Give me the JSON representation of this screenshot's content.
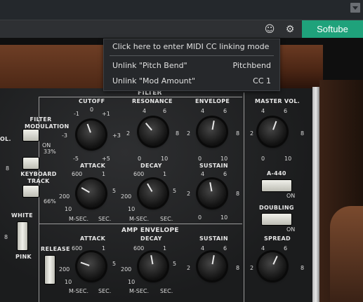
{
  "toolbar": {
    "brand": "Softube",
    "dropdown_icon": "chevron-down-icon",
    "face_icon": "face-icon",
    "settings_icon": "gear-icon"
  },
  "context_menu": {
    "items": [
      {
        "label": "Click here to enter MIDI CC linking mode",
        "shortcut": ""
      },
      {
        "label": "Unlink \"Pitch Bend\"",
        "shortcut": "Pitchbend"
      },
      {
        "label": "Unlink \"Mod Amount\"",
        "shortcut": "CC 1"
      }
    ]
  },
  "synth": {
    "section_filter": "FILTER",
    "section_amp": "AMP ENVELOPE",
    "filter_modulation": "FILTER MODULATION",
    "on": "ON",
    "keyboard_track": "KEYBOARD TRACK",
    "kbd_33": "33%",
    "kbd_66": "66%",
    "white": "WHITE",
    "pink": "PINK",
    "release": "RELEASE",
    "vol_partial": "OL.",
    "eight": "8",
    "cutoff": {
      "label": "CUTOFF",
      "ticks": [
        "-1",
        "0",
        "+1",
        "-3",
        "+3",
        "-5",
        "+5"
      ]
    },
    "resonance": {
      "label": "RESONANCE",
      "ticks": [
        "4",
        "6",
        "2",
        "8",
        "0",
        "10"
      ]
    },
    "envelope": {
      "label": "ENVELOPE",
      "ticks": [
        "4",
        "6",
        "2",
        "8",
        "0",
        "10"
      ]
    },
    "master_vol": {
      "label": "MASTER VOL.",
      "ticks": [
        "4",
        "6",
        "2",
        "8",
        "0",
        "10"
      ]
    },
    "filter_attack": {
      "label": "ATTACK",
      "ticks": [
        "600",
        "1",
        "200",
        "5",
        "10",
        "M-SEC.",
        "SEC."
      ]
    },
    "filter_decay": {
      "label": "DECAY",
      "ticks": [
        "600",
        "1",
        "200",
        "5",
        "10",
        "M-SEC.",
        "SEC."
      ]
    },
    "filter_sustain": {
      "label": "SUSTAIN",
      "ticks": [
        "4",
        "6",
        "2",
        "8",
        "0",
        "10"
      ]
    },
    "a440": "A-440",
    "doubling": "DOUBLING",
    "amp_attack": {
      "label": "ATTACK",
      "ticks": [
        "600",
        "1",
        "200",
        "5",
        "10",
        "M-SEC.",
        "SEC."
      ]
    },
    "amp_decay": {
      "label": "DECAY",
      "ticks": [
        "600",
        "1",
        "200",
        "5",
        "10",
        "M-SEC.",
        "SEC."
      ]
    },
    "amp_sustain": {
      "label": "SUSTAIN",
      "ticks": [
        "4",
        "6",
        "2",
        "8"
      ]
    },
    "spread": {
      "label": "SPREAD",
      "ticks": [
        "4",
        "6",
        "2",
        "8"
      ]
    }
  }
}
